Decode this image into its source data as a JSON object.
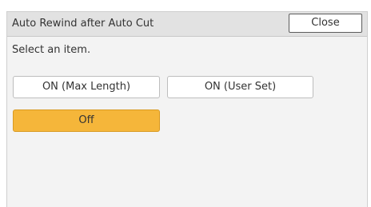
{
  "dialog": {
    "title": "Auto Rewind after Auto Cut",
    "close_label": "Close",
    "instruction": "Select an item.",
    "options": [
      {
        "label": "ON (Max Length)",
        "selected": false
      },
      {
        "label": "ON (User Set)",
        "selected": false
      },
      {
        "label": "Off",
        "selected": true
      }
    ]
  },
  "colors": {
    "selected": "#f5b63a",
    "titlebar": "#e2e2e2",
    "panel": "#f3f3f3"
  }
}
